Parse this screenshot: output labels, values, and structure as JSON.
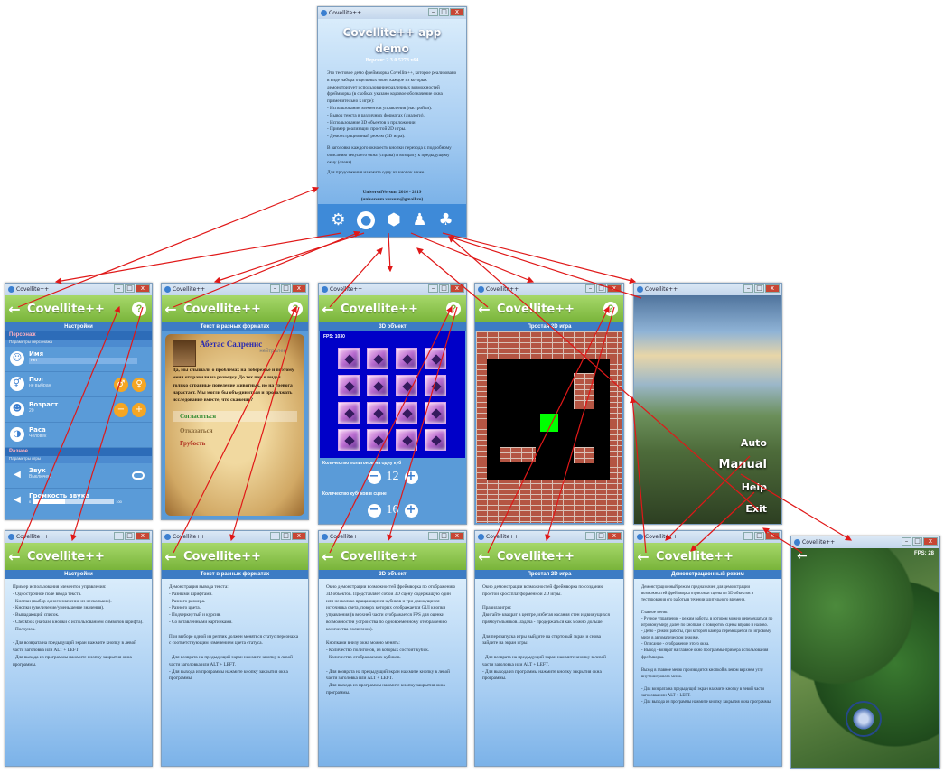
{
  "app_name": "Covellite++",
  "window_caption": "Covellite++",
  "main": {
    "title": "Covellite++ app demo",
    "version": "Версия: 2.3.0.5278 x64",
    "intro": "Это тестовое демо фреймворка Covellite++, которое реализовано в виде набора отдельных окон, каждое из которых демонстрирует использование различных возможностей фреймворка (в скобках указано кодовое обозначение окна применительно к игре):",
    "items": [
      "- Использование элементов управления (настройки).",
      "- Вывод текста в различных форматах (диалоги).",
      "- Использование 3D объектов в приложении.",
      "- Пример реализации простой 2D игры.",
      "- Демонстрационный режим (3D игра)."
    ],
    "nav_note": "В заголовке каждого окна есть кнопки перехода к подробному описанию текущего окна (справа) и возврату к предыдущему окну (слева).",
    "continue_note": "Для продолжения нажмите одну из кнопок ниже.",
    "author": "UniversalVersum 2016 - 2019",
    "email": "(universum.versum@gmail.ru)"
  },
  "settings": {
    "header": "Настройки",
    "section1": "Персонаж",
    "section1_sub": "Параметры персонажа",
    "name_label": "Имя",
    "name_value": "нет",
    "gender_label": "Пол",
    "gender_value": "не выбран",
    "age_label": "Возраст",
    "age_value": "20",
    "race_label": "Раса",
    "race_value": "Человек",
    "section2": "Разное",
    "section2_sub": "Параметры игры",
    "sound_label": "Звук",
    "sound_value": "Выключен",
    "volume_label": "Громкость звука",
    "volume_min": "0",
    "volume_max": "100"
  },
  "dialog": {
    "header": "Текст в разных форматах",
    "npc_name": "Абетас Салренис",
    "npc_status": "нейтрален",
    "speech": "Да, мы слышали о проблемах на побережье и поэтому меня отправили на разведку. До тех пор я видел только странные поведение животных, но на тревога нарастает. Мы могли бы объединиться и продолжать исследование вместе, что скажешь?",
    "opt1": "Согласиться",
    "opt2": "Отказаться",
    "opt3": "Грубость"
  },
  "objects3d": {
    "header": "3D объект",
    "fps": "FPS: 1030",
    "polygons_label": "Количество полигонов на одну куб",
    "polygons_value": "12",
    "cubes_label": "Количество кубиков в сцене",
    "cubes_value": "16"
  },
  "game2d": {
    "header": "Простая 2D игра"
  },
  "demo_menu": {
    "items": [
      "Auto",
      "Manual",
      "Help",
      "Exit"
    ]
  },
  "help_settings": {
    "header": "Настройки",
    "lines": [
      "Пример использования элементов управления:",
      "- Однострочное поле ввода текста.",
      "- Кнопки (выбор одного значения из нескольких).",
      "- Кнопки (увеличение/уменьшение значения).",
      "- Выпадающий список.",
      "- Checkbox (на базе кнопки с использованием символов шрифта).",
      "- Ползунок.",
      "",
      "- Для возврата на предыдущий экран нажмите кнопку в левой части заголовка или ALT + LEFT.",
      "- Для выхода из программы нажмите кнопку закрытия окна программы."
    ]
  },
  "help_text": {
    "header": "Текст в разных форматах",
    "lines": [
      "Демонстрация вывода текста:",
      "- Разными шрифтами.",
      "- Разного размера.",
      "- Разного цвета.",
      "- Подчеркнутый и курсив.",
      "- Со вставленными картинками.",
      "",
      "При выборе одной из реплик должен меняться статус персонажа с соответствующим изменением цвета статуса.",
      "",
      "- Для возврата на предыдущий экран нажмите кнопку в левой части заголовка или ALT + LEFT.",
      "- Для выхода из программы нажмите кнопку закрытия окна программы."
    ]
  },
  "help_3d": {
    "header": "3D объект",
    "lines": [
      "Окно демонстрации возможностей фреймворка по отображению 3D объектов. Представляет собой 3D сцену содержащую один или несколько вращающихся кубиков и три движущихся источника света, поверх которых отображается GUI кнопки управления (в верхней части отображается FPS для оценки возможностей устройства по одновременному отображению количества полигонов).",
      "",
      "Кнопками внизу окна можно менять:",
      "- Количество полигонов, из которых состоит кубик.",
      "- Количество отображаемых кубиков.",
      "",
      "- Для возврата на предыдущий экран нажмите кнопку в левой части заголовка или ALT + LEFT.",
      "- Для выхода из программы нажмите кнопку закрытия окна программы."
    ]
  },
  "help_2d": {
    "header": "Простая 2D игра",
    "lines": [
      "Окно демонстрации возможностей фреймворка по созданию простой кроссплатформенной 2D игры.",
      "",
      "Правила игры:",
      "Двигайте квадрат в центре, избегая касания стен и движущихся прямоугольников. Задача - продержаться как можно дольше.",
      "",
      "Для перезапуска игры выйдите на стартовый экран и снова зайдите на экран игры.",
      "",
      "- Для возврата на предыдущий экран нажмите кнопку в левой части заголовка или ALT + LEFT.",
      "- Для выхода из программы нажмите кнопку закрытия окна программы."
    ]
  },
  "help_demo": {
    "header": "Демонстрационный режим",
    "lines": [
      "Демонстрационный режим предназначен для демонстрации возможностей фреймворка отрисовки сцены из 3D объектов и тестирования его работы в течении длительного времени.",
      "",
      "Главное меню:",
      "- Ручное управление - режим работы, в котором можно перемещаться по игровому миру далее по кнопкам с поворотом сцены вправо и налево.",
      "- Демо - режим работы, при котором камера перемещается по игровому миру в автоматическом режиме.",
      "- Описание - отображение этого окна.",
      "- Выход - возврат на главное окно программы-примера использования фреймворка.",
      "",
      "Выход в главное меню производится кнопкой в левом верхнем углу внутриигрового меню.",
      "",
      "- Для возврата на предыдущий экран нажмите кнопку в левой части заголовка или ALT + LEFT.",
      "- Для выхода из программы нажмите кнопку закрытия окна программы."
    ]
  },
  "game3d": {
    "fps": "FPS: 28"
  }
}
